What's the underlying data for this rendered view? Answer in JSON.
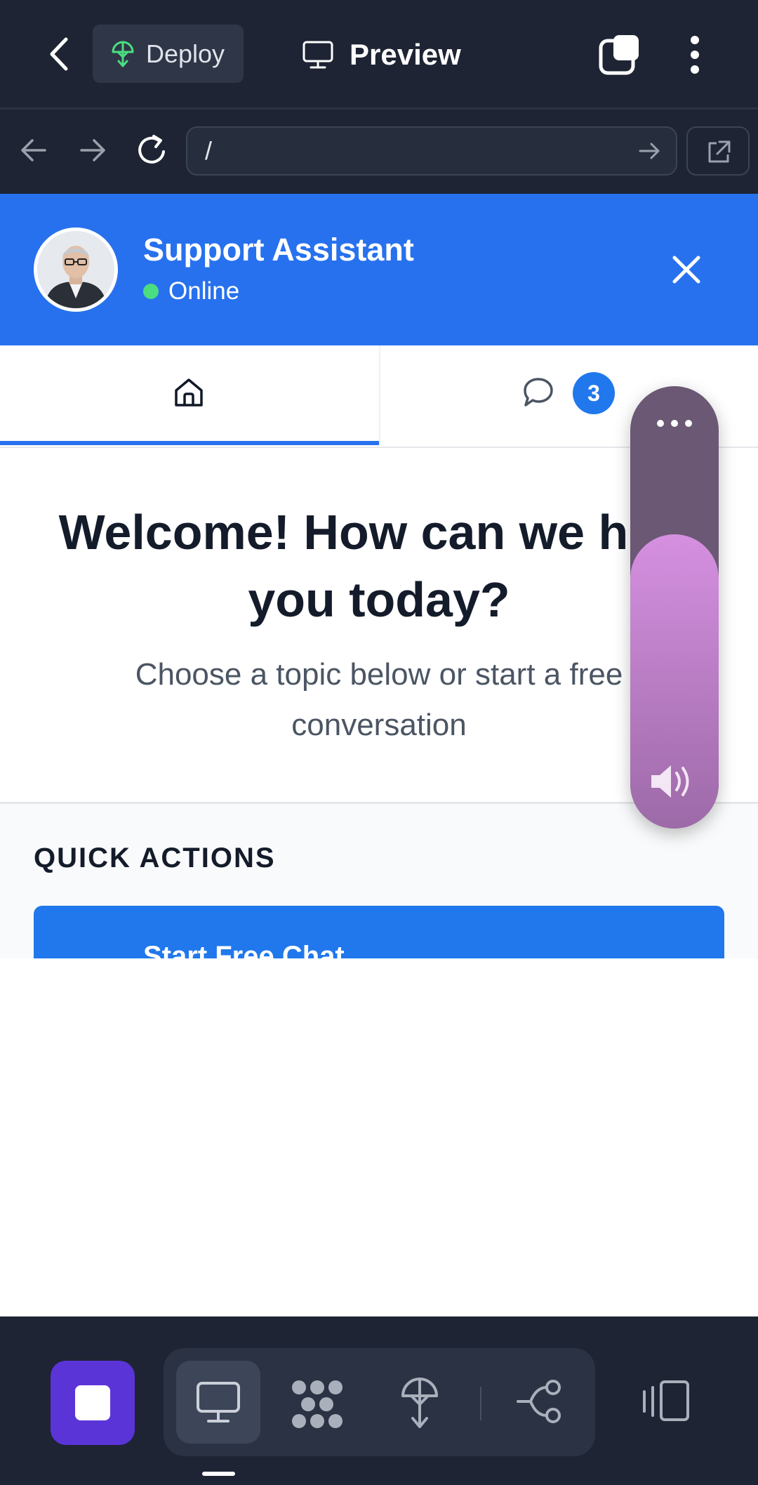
{
  "topbar": {
    "deploy_label": "Deploy",
    "preview_label": "Preview",
    "icons": [
      "back-chevron-icon",
      "deploy-icon",
      "monitor-icon",
      "tabs-icon",
      "more-vertical-icon"
    ]
  },
  "browser": {
    "url": "/",
    "icons": [
      "arrow-left-icon",
      "arrow-right-icon",
      "reload-icon",
      "go-arrow-icon",
      "external-link-icon"
    ]
  },
  "chat_header": {
    "title": "Support Assistant",
    "status": "Online",
    "status_color": "#4ade80",
    "accent_color": "#2771ee"
  },
  "tabs": [
    {
      "name": "home",
      "icon": "home-icon",
      "active": true
    },
    {
      "name": "messages",
      "icon": "chat-bubble-icon",
      "badge": "3",
      "active": false
    }
  ],
  "welcome": {
    "title": "Welcome! How can we help you today?",
    "subtitle": "Choose a topic below or start a free conversation"
  },
  "quick_actions": {
    "heading": "QUICK ACTIONS",
    "items": [
      {
        "label": "Start Free Chat"
      }
    ]
  },
  "volume": {
    "level": 0.665,
    "icon": "speaker-icon"
  },
  "bottom_toolbar": {
    "items": [
      "stop-button",
      "monitor-icon",
      "components-icon",
      "deploy-icon",
      "share-icon",
      "device-toggle-icon"
    ],
    "brand_color": "#5b34d8"
  }
}
